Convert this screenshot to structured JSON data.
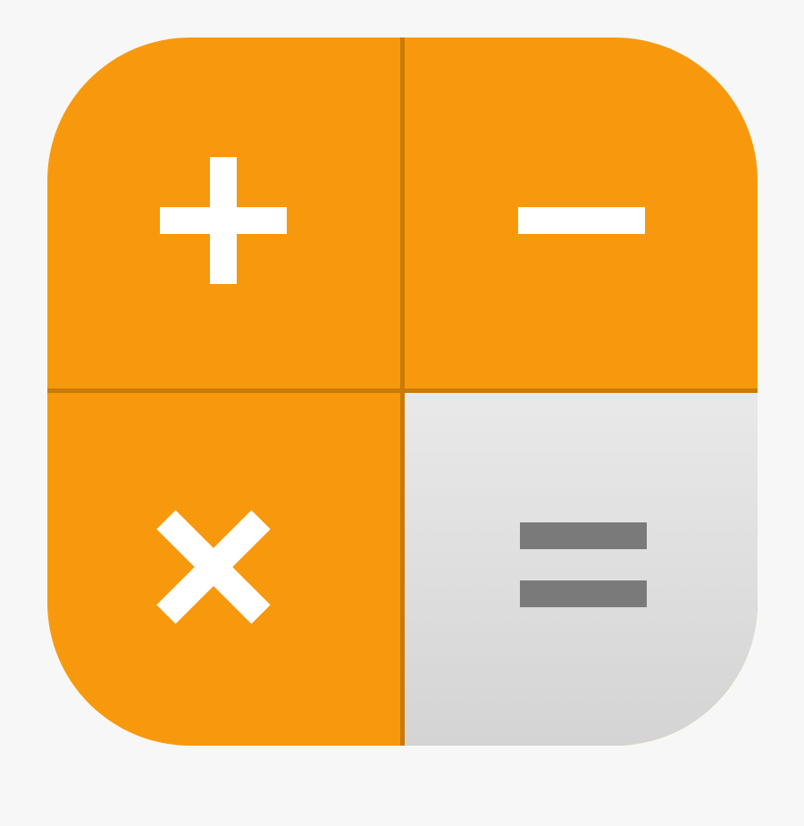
{
  "icon": {
    "name": "Calculator",
    "symbols": [
      "plus",
      "minus",
      "multiply",
      "equals"
    ],
    "colors": {
      "background": "#f7f7f7",
      "operator_tile": "#f8990d",
      "divider": "#c87a0a",
      "glyph_light": "#ffffff",
      "equals_tile_top": "#e9e9e9",
      "equals_tile_bottom": "#d4d4d4",
      "glyph_dark": "#7a7a7a"
    }
  }
}
